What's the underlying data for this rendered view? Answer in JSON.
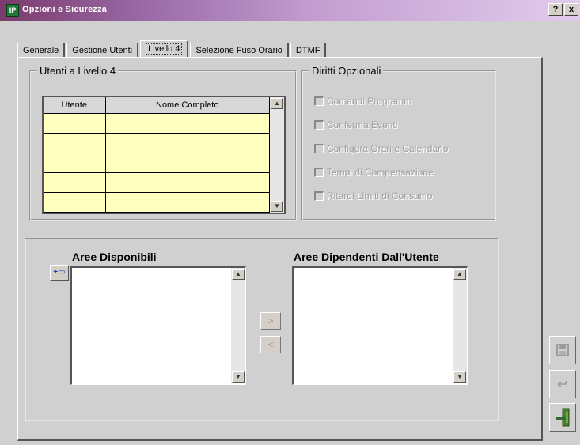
{
  "window": {
    "title": "Opzioni e Sicurezza",
    "icon": "app-icon",
    "help_label": "?",
    "close_label": "x"
  },
  "tabs": [
    {
      "label": "Generale"
    },
    {
      "label": "Gestione Utenti"
    },
    {
      "label": "Livello 4",
      "active": true
    },
    {
      "label": "Selezione Fuso Orario"
    },
    {
      "label": "DTMF"
    }
  ],
  "users": {
    "title": "Utenti a Livello 4",
    "columns": [
      "Utente",
      "Nome Completo"
    ],
    "rows": [
      [
        "",
        ""
      ],
      [
        "",
        ""
      ],
      [
        "",
        ""
      ],
      [
        "",
        ""
      ],
      [
        "",
        ""
      ],
      [
        "",
        ""
      ]
    ]
  },
  "rights": {
    "title": "Diritti Opzionali",
    "items": [
      {
        "label": "Comandi Programm"
      },
      {
        "label": "Conferma Eventi"
      },
      {
        "label": "Configura Orari e Calendario"
      },
      {
        "label": "Tempi di Compensazione"
      },
      {
        "label": "Ritardi Limiti di Consumo"
      }
    ]
  },
  "areas": {
    "available_title": "Aree Disponibili",
    "dependent_title": "Aree Dipendenti Dall'Utente",
    "move_right_label": ">",
    "move_left_label": "<"
  },
  "icons": {
    "save": "save-icon",
    "undo": "undo-icon",
    "exit": "exit-icon",
    "add_area": "add-area-icon"
  },
  "colors": {
    "grid_cell": "#ffffc0",
    "title_gradient_start": "#7a3b6b",
    "title_gradient_end": "#e1ccec"
  }
}
